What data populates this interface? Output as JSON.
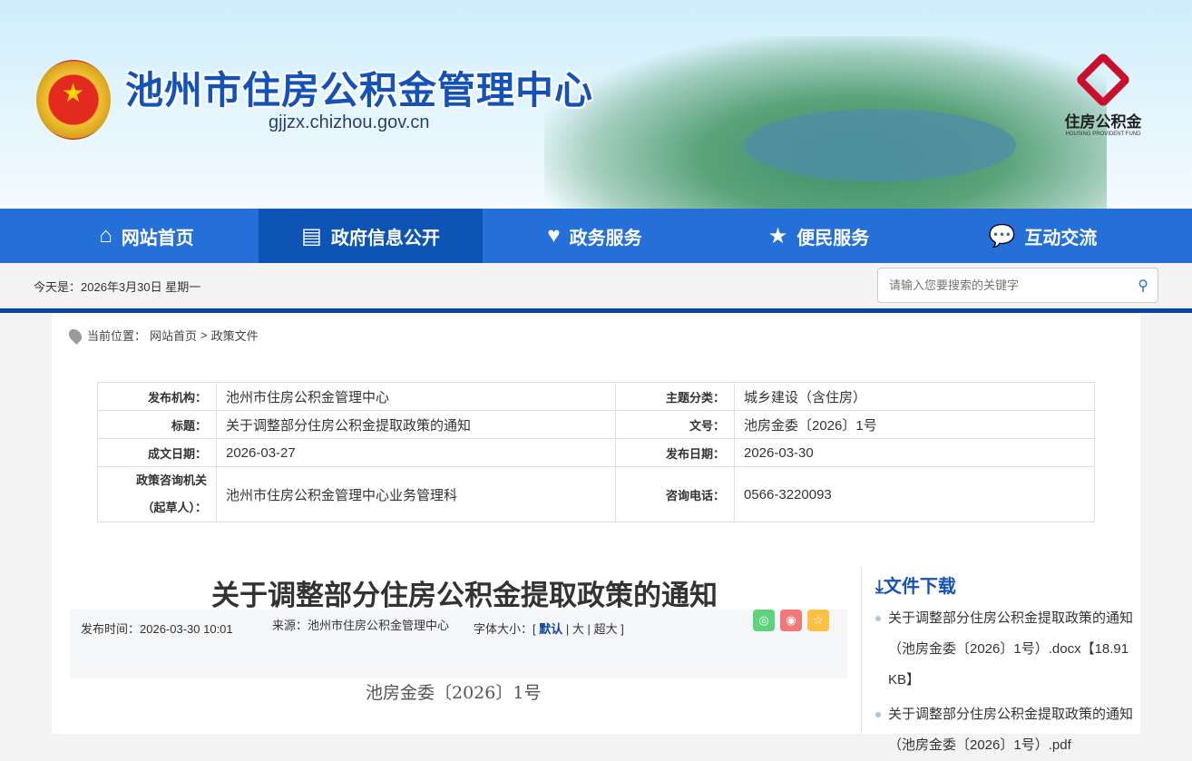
{
  "header": {
    "title": "池州市住房公积金管理中心",
    "url": "gjjzx.chizhou.gov.cn",
    "fund_logo_cn": "住房公积金",
    "fund_logo_en": "HOUSING PROVIDENT FUND"
  },
  "nav": [
    {
      "label": "网站首页",
      "icon": "home-icon"
    },
    {
      "label": "政府信息公开",
      "icon": "book-icon"
    },
    {
      "label": "政务服务",
      "icon": "heart-hands-icon"
    },
    {
      "label": "便民服务",
      "icon": "star-bookmark-icon"
    },
    {
      "label": "互动交流",
      "icon": "chat-icon"
    }
  ],
  "today": "今天是：2026年3月30日 星期一",
  "search": {
    "placeholder": "请输入您要搜索的关键字"
  },
  "breadcrumb": {
    "label": "当前位置：",
    "home": "网站首页",
    "sep": ">",
    "current": "政策文件"
  },
  "meta": {
    "publisher_k": "发布机构：",
    "publisher": "池州市住房公积金管理中心",
    "topic_k": "主题分类：",
    "topic": "城乡建设（含住房）",
    "title_k": "标题：",
    "title": "关于调整部分住房公积金提取政策的通知",
    "docno_k": "文号：",
    "docno": "池房金委〔2026〕1号",
    "created_k": "成文日期：",
    "created": "2026-03-27",
    "pubdate_k": "发布日期：",
    "pubdate": "2026-03-30",
    "consult_k1": "政策咨询机关",
    "consult_k2": "（起草人）：",
    "consult": "池州市住房公积金管理中心业务管理科",
    "phone_k": "咨询电话：",
    "phone": "0566-3220093"
  },
  "article": {
    "title": "关于调整部分住房公积金提取政策的通知",
    "pub_time": "发布时间：2026-03-30 10:01",
    "source": "来源：池州市住房公积金管理中心",
    "font_label": "字体大小：[",
    "font_default": "默认",
    "font_sep1": "|",
    "font_large": "大",
    "font_sep2": "|",
    "font_xlarge": "超大",
    "font_end": "]",
    "docno": "池房金委〔2026〕1号"
  },
  "downloads": {
    "title": "文件下载",
    "items": [
      "关于调整部分住房公积金提取政策的通知（池房金委〔2026〕1号）.docx【18.91 KB】",
      "关于调整部分住房公积金提取政策的通知（池房金委〔2026〕1号）.pdf"
    ]
  }
}
